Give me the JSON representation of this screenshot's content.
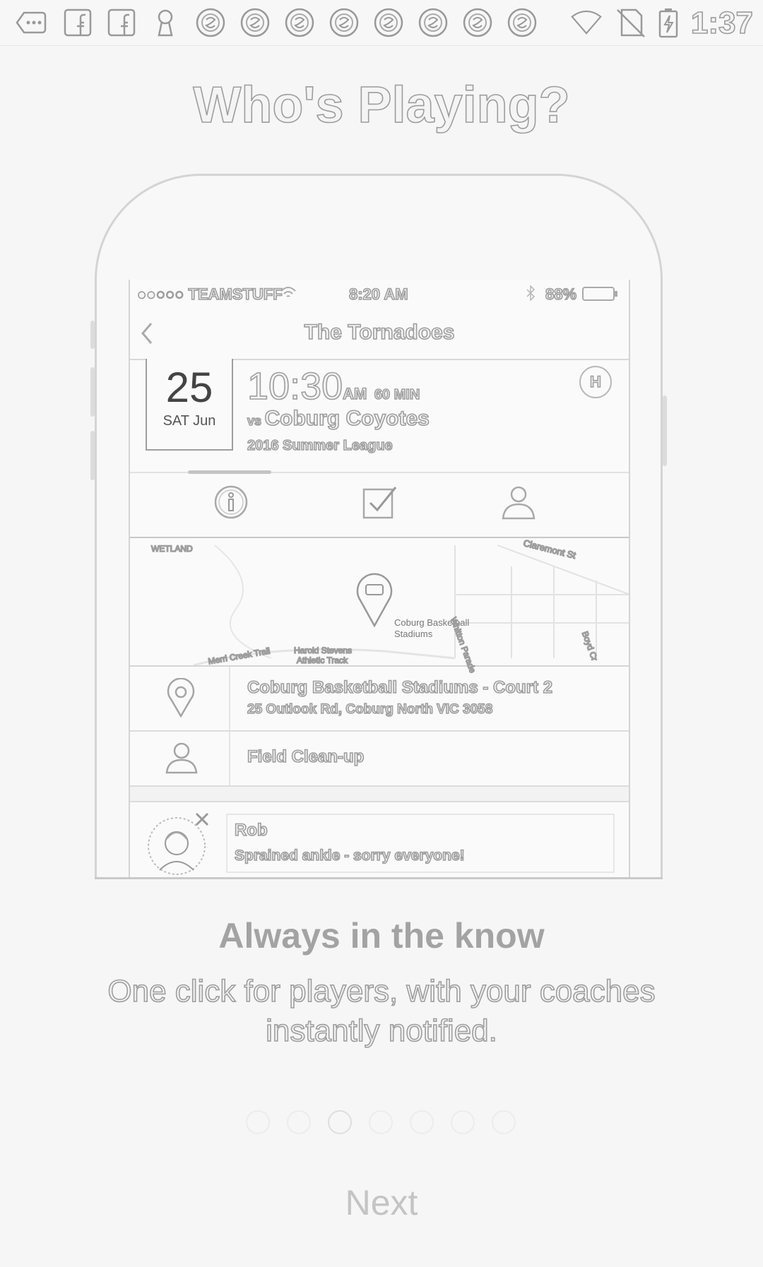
{
  "status_bar": {
    "time": "1:37",
    "notification_icons": [
      "overflow-icon",
      "facebook-icon",
      "facebook-icon",
      "keyhole-icon",
      "app-icon",
      "app-icon",
      "app-icon",
      "app-icon",
      "app-icon",
      "app-icon",
      "app-icon",
      "app-icon"
    ],
    "system_icons": [
      "wifi-icon",
      "no-sim-icon",
      "battery-charging-icon"
    ]
  },
  "headline": "Who's Playing?",
  "mockup": {
    "ios_status": {
      "carrier": "●●○○○ TEAMSTUFF",
      "time": "8:20 AM",
      "battery": "88%"
    },
    "nav_title": "The Tornadoes",
    "event": {
      "day": "25",
      "weekday_month": "SAT Jun",
      "time": "10:30",
      "ampm": "AM",
      "duration": "60 MIN",
      "vs_prefix": "vs",
      "opponent": "Coburg Coyotes",
      "league": "2016 Summer League",
      "home_badge": "H"
    },
    "map": {
      "labels": [
        "WETLAND",
        "Claremont St",
        "Coburg Basketball",
        "Stadiums",
        "Whitton Parade",
        "Boyd Cr",
        "Merri Creek Trail",
        "Harold Stevens",
        "Athletic Track"
      ]
    },
    "venue": {
      "name": "Coburg Basketball Stadiums - Court 2",
      "address": "25 Outlook Rd, Coburg North VIC 3058"
    },
    "duty": "Field Clean-up",
    "comment": {
      "name": "Rob",
      "text": "Sprained ankle - sorry everyone!"
    }
  },
  "feature": {
    "title": "Always in the know",
    "description_line1": "One click for players, with your coaches",
    "description_line2": "instantly notified."
  },
  "pager": {
    "count": 7,
    "active_index": 2
  },
  "next_label": "Next"
}
